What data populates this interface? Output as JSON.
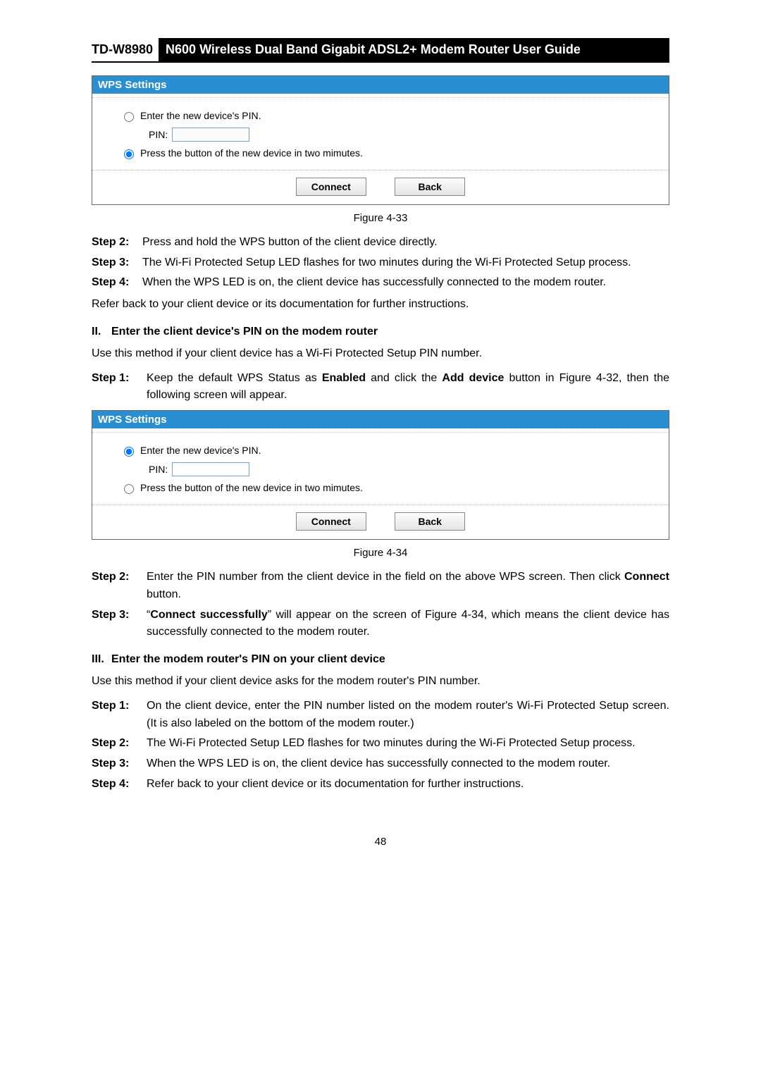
{
  "header": {
    "model": "TD-W8980",
    "title": "N600 Wireless Dual Band Gigabit ADSL2+ Modem Router User Guide"
  },
  "wps1": {
    "title": "WPS Settings",
    "opt_pin": "Enter the new device's PIN.",
    "pin_label": "PIN:",
    "pin_value": "",
    "opt_button": "Press the button of the new device in two mimutes.",
    "connect": "Connect",
    "back": "Back"
  },
  "fig1": "Figure 4-33",
  "steps_a": {
    "s2_label": "Step 2:",
    "s2_text": "Press and hold the WPS button of the client device directly.",
    "s3_label": "Step 3:",
    "s3_text": "The Wi-Fi Protected Setup LED flashes for two minutes during the Wi-Fi Protected Setup process.",
    "s4_label": "Step 4:",
    "s4_text": "When the WPS LED is on, the client device has successfully connected to the modem router."
  },
  "refer1": "Refer back to your client device or its documentation for further instructions.",
  "sec2": {
    "num": "II.",
    "title": "Enter the client device's PIN on the modem router",
    "intro": "Use this method if your client device has a Wi-Fi Protected Setup PIN number.",
    "s1_label": "Step 1:",
    "s1_pre": "Keep the default WPS Status as ",
    "s1_b1": "Enabled",
    "s1_mid": " and click the ",
    "s1_b2": "Add device",
    "s1_post": " button in Figure 4-32, then the following screen will appear."
  },
  "wps2": {
    "title": "WPS Settings",
    "opt_pin": "Enter the new device's PIN.",
    "pin_label": "PIN:",
    "pin_value": "",
    "opt_button": "Press the button of the new device in two mimutes.",
    "connect": "Connect",
    "back": "Back"
  },
  "fig2": "Figure 4-34",
  "steps_b": {
    "s2_label": "Step 2:",
    "s2_pre": "Enter the PIN number from the client device in the field on the above WPS screen. Then click ",
    "s2_b": "Connect",
    "s2_post": " button.",
    "s3_label": "Step 3:",
    "s3_pre": "“",
    "s3_b": "Connect successfully",
    "s3_post": "” will appear on the screen of Figure 4-34, which means the client device has successfully connected to the modem router."
  },
  "sec3": {
    "num": "III.",
    "title": "Enter the modem router's PIN on your client device",
    "intro": "Use this method if your client device asks for the modem router's PIN number.",
    "s1_label": "Step 1:",
    "s1_text": "On the client device, enter the PIN number listed on the modem router's Wi-Fi Protected Setup screen. (It is also labeled on the bottom of the modem router.)",
    "s2_label": "Step 2:",
    "s2_text": "The Wi-Fi Protected Setup LED flashes for two minutes during the Wi-Fi Protected Setup process.",
    "s3_label": "Step 3:",
    "s3_text": "When the WPS LED is on, the client device has successfully connected to the modem router.",
    "s4_label": "Step 4:",
    "s4_text": "Refer back to your client device or its documentation for further instructions."
  },
  "page_number": "48"
}
